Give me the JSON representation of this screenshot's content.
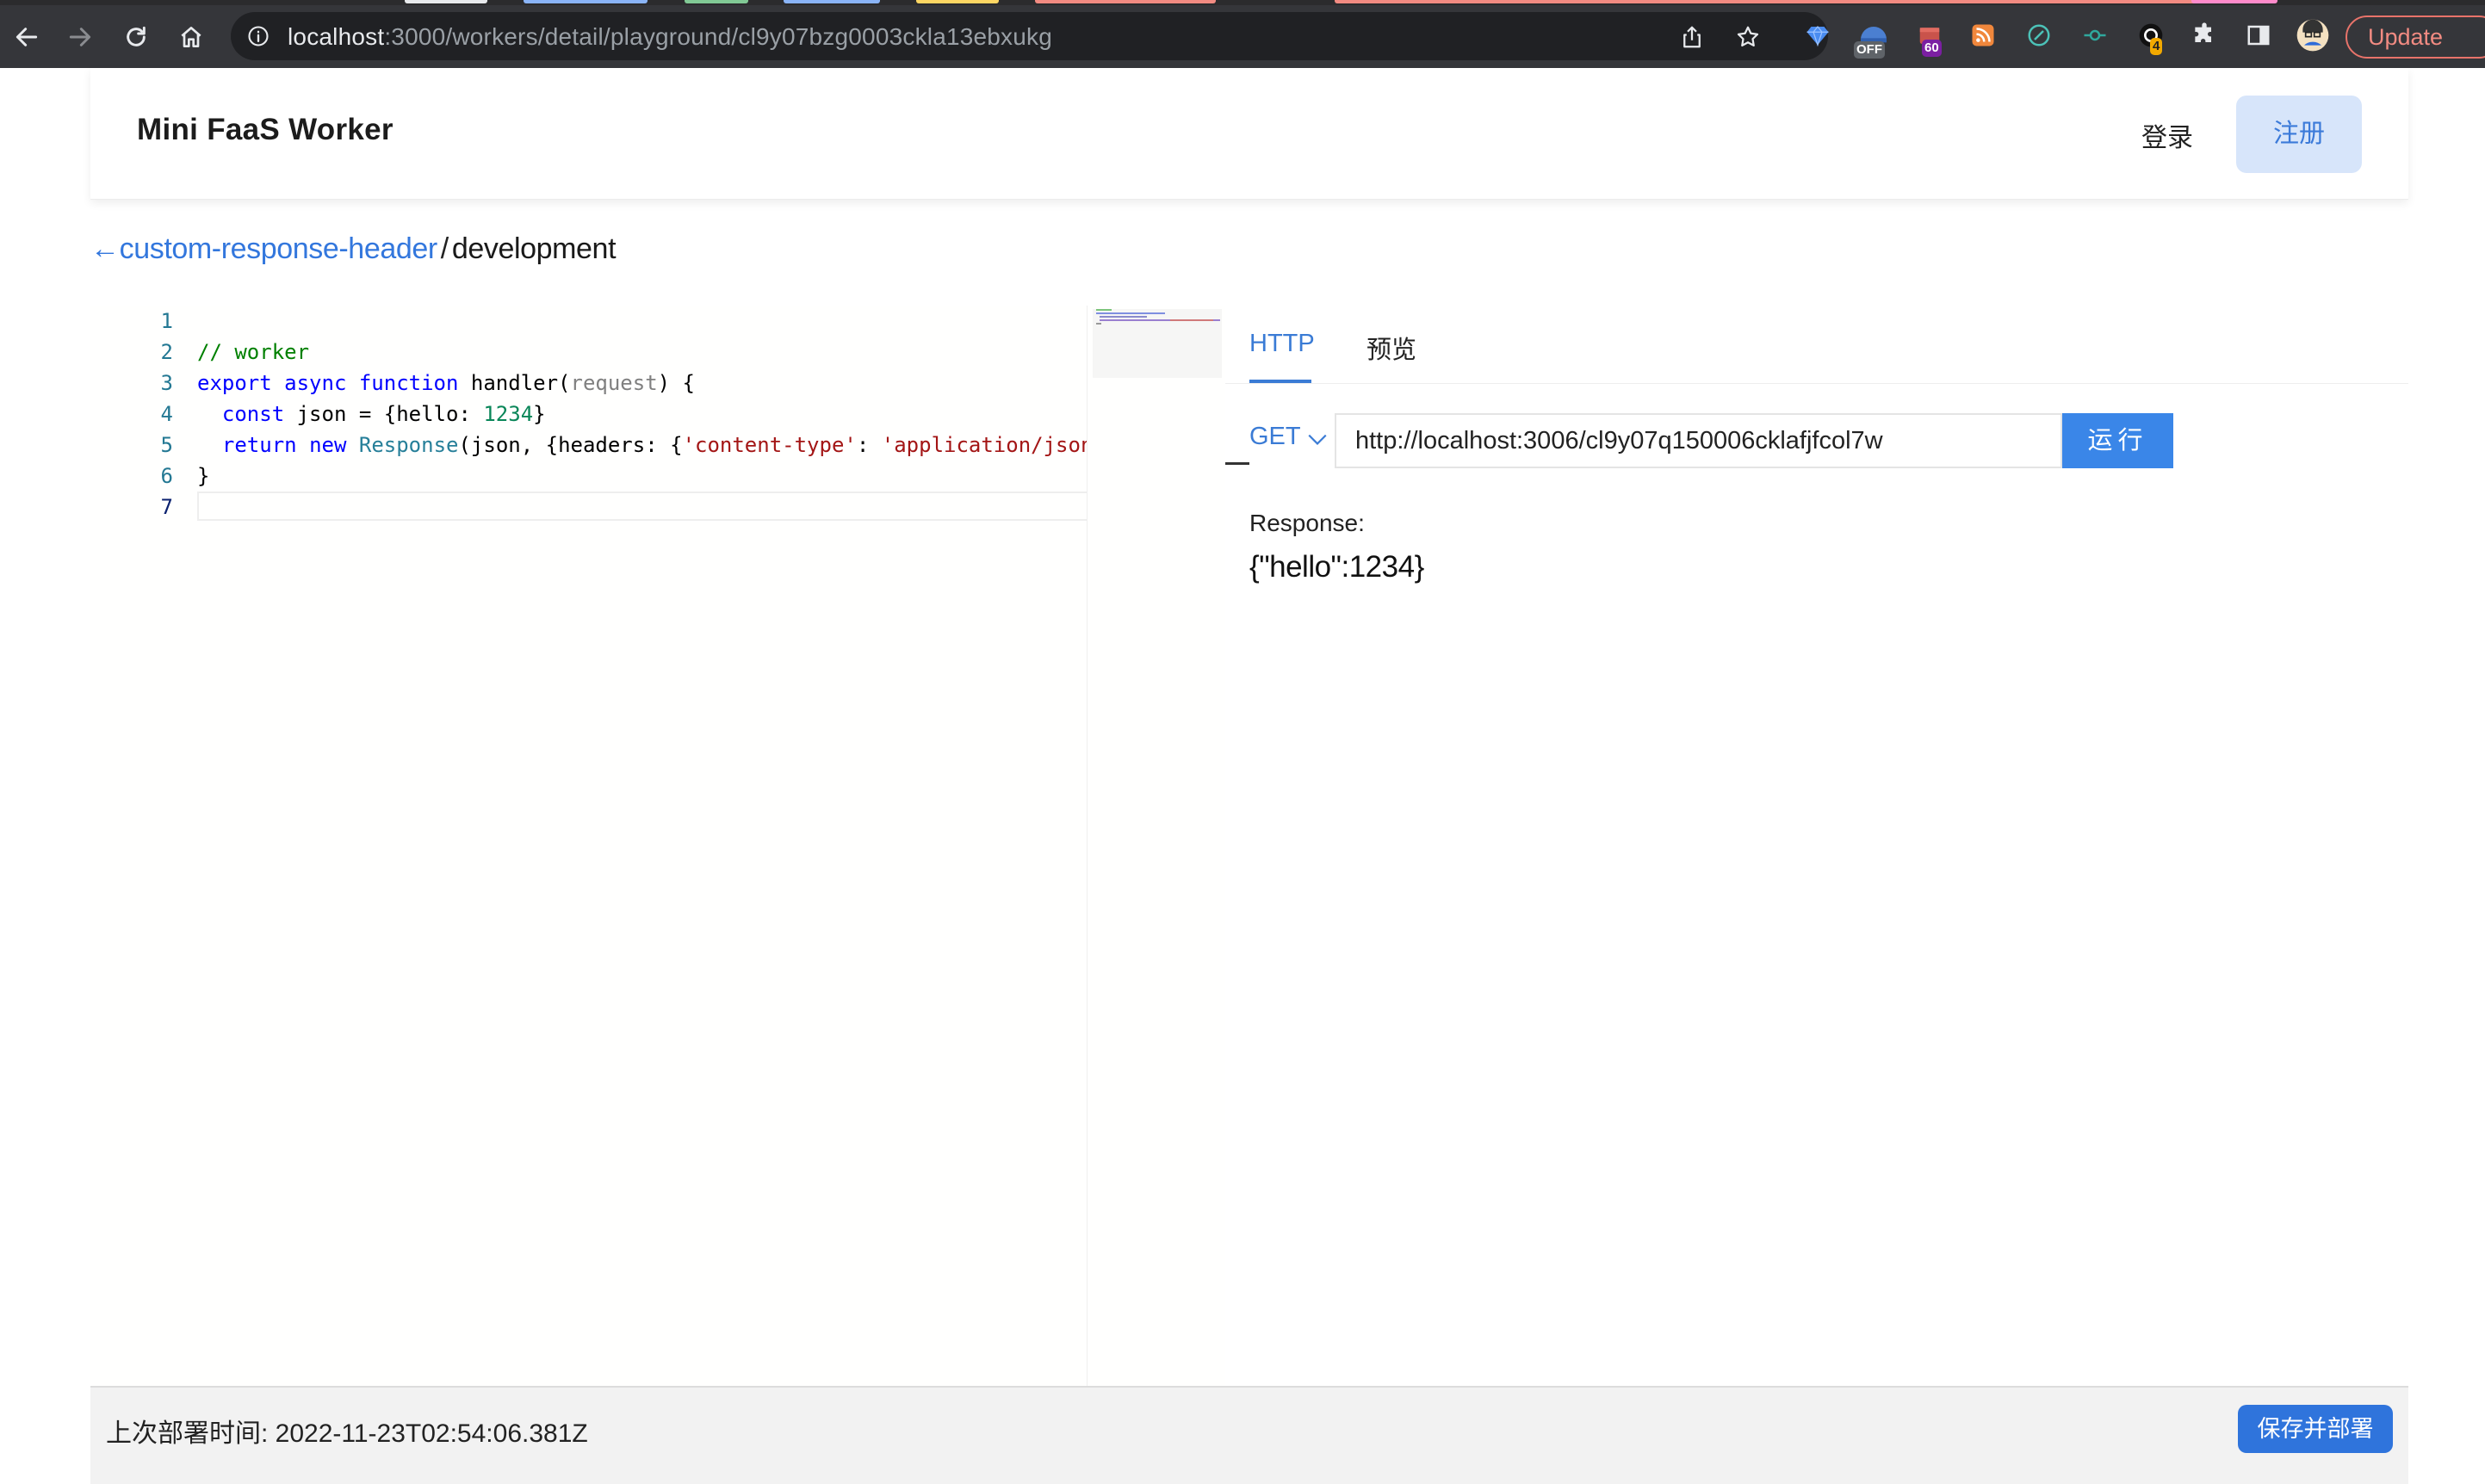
{
  "browser": {
    "url_host": "localhost",
    "url_rest": ":3000/workers/detail/playground/cl9y07bzg0003ckla13ebxukg",
    "update_label": "Update",
    "extension_badges": {
      "ext_off": "OFF",
      "ext_count": "60",
      "ext_four": "4"
    }
  },
  "header": {
    "title": "Mini FaaS Worker",
    "login_label": "登录",
    "register_label": "注册"
  },
  "breadcrumb": {
    "back_arrow": "←",
    "worker_name": "custom-response-header",
    "separator": "/",
    "environment": "development"
  },
  "editor": {
    "line_numbers": [
      "1",
      "2",
      "3",
      "4",
      "5",
      "6",
      "7"
    ],
    "code": {
      "l2_comment": "// worker",
      "l3_export": "export",
      "l3_async": "async",
      "l3_function": "function",
      "l3_name": " handler(",
      "l3_param": "request",
      "l3_close": ") {",
      "l4_indent": "  ",
      "l4_const": "const",
      "l4_mid": " json = {hello: ",
      "l4_num": "1234",
      "l4_end": "}",
      "l5_indent": "  ",
      "l5_return": "return",
      "l5_new": "new",
      "l5_type": "Response",
      "l5_mid": "(json, {headers: {",
      "l5_str1": "'content-type'",
      "l5_colon": ": ",
      "l5_str2": "'application/json'",
      "l6_close": "}"
    }
  },
  "panel": {
    "tabs": [
      "HTTP",
      "预览"
    ],
    "method": "GET",
    "request_url": "http://localhost:3006/cl9y07q150006cklafjfcol7w",
    "run_label": "运行",
    "response_label": "Response:",
    "response_body": "{\"hello\":1234}"
  },
  "footer": {
    "deploy_time_label": "上次部署时间: 2022-11-23T02:54:06.381Z",
    "save_deploy_label": "保存并部署"
  },
  "colors": {
    "accent": "#3a7bd5",
    "register_bg": "#d7e5fa",
    "run_button": "#3a86e8",
    "save_button": "#2f74dc",
    "chrome_toolbar": "#35363a"
  }
}
